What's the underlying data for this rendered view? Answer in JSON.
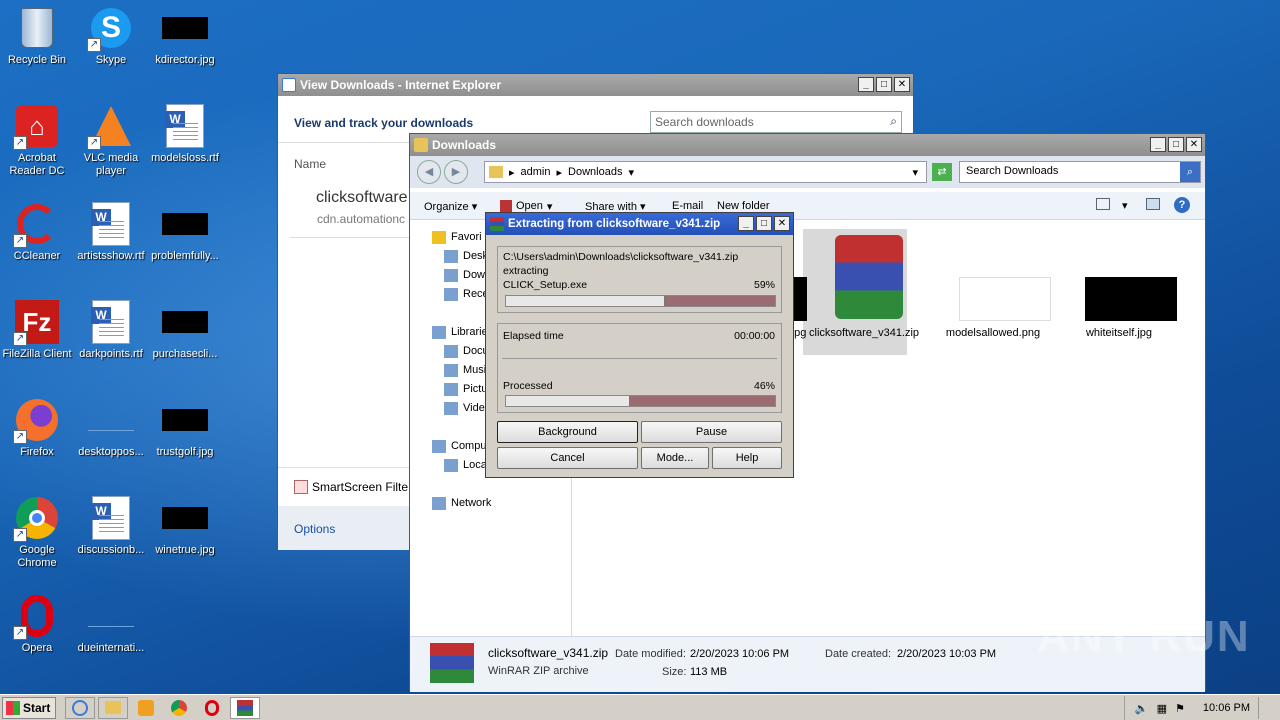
{
  "desktop": {
    "icons": [
      {
        "label": "Recycle Bin",
        "icon": "recycle-bin-icon"
      },
      {
        "label": "Skype",
        "icon": "skype-icon"
      },
      {
        "label": "kdirector.jpg",
        "icon": "image-file-icon"
      },
      {
        "label": "Acrobat Reader DC",
        "icon": "acrobat-icon"
      },
      {
        "label": "VLC media player",
        "icon": "vlc-icon"
      },
      {
        "label": "modelsloss.rtf",
        "icon": "word-document-icon"
      },
      {
        "label": "CCleaner",
        "icon": "ccleaner-icon"
      },
      {
        "label": "artistsshow.rtf",
        "icon": "word-document-icon"
      },
      {
        "label": "problemfully...",
        "icon": "image-file-icon"
      },
      {
        "label": "FileZilla Client",
        "icon": "filezilla-icon"
      },
      {
        "label": "darkpoints.rtf",
        "icon": "word-document-icon"
      },
      {
        "label": "purchasecli...",
        "icon": "image-file-icon"
      },
      {
        "label": "Firefox",
        "icon": "firefox-icon"
      },
      {
        "label": "desktoppos...",
        "icon": "image-file-icon"
      },
      {
        "label": "trustgolf.jpg",
        "icon": "image-file-icon"
      },
      {
        "label": "Google Chrome",
        "icon": "chrome-icon"
      },
      {
        "label": "discussionb...",
        "icon": "word-document-icon"
      },
      {
        "label": "winetrue.jpg",
        "icon": "image-file-icon"
      },
      {
        "label": "Opera",
        "icon": "opera-icon"
      },
      {
        "label": "dueinternati...",
        "icon": "image-file-icon"
      }
    ]
  },
  "ie_window": {
    "title": "View Downloads - Internet Explorer",
    "heading": "View and track your downloads",
    "search_placeholder": "Search downloads",
    "column_name": "Name",
    "item_name": "clicksoftware.",
    "item_source": "cdn.automationc",
    "smartscreen": "SmartScreen Filte",
    "options": "Options"
  },
  "explorer": {
    "title": "Downloads",
    "breadcrumb": [
      "admin",
      "Downloads"
    ],
    "search_placeholder": "Search Downloads",
    "toolbar": [
      "Organize",
      "Open",
      "Share with",
      "E-mail",
      "New folder"
    ],
    "nav": [
      "Favori",
      "Desk",
      "Dow",
      "Rece",
      "Librarie",
      "Docu",
      "Musi",
      "Pictu",
      "Vide",
      "Compu",
      "Loca",
      "Network"
    ],
    "files": [
      {
        "name": "...pg",
        "kind": "black"
      },
      {
        "name": "clicksoftware_v341.zip",
        "kind": "winrar"
      },
      {
        "name": "modelsallowed.png",
        "kind": "white"
      },
      {
        "name": "whiteitself.jpg",
        "kind": "black"
      }
    ],
    "details": {
      "name": "clicksoftware_v341.zip",
      "type": "WinRAR ZIP archive",
      "modified_label": "Date modified:",
      "modified": "2/20/2023 10:06 PM",
      "created_label": "Date created:",
      "created": "2/20/2023 10:03 PM",
      "size_label": "Size:",
      "size": "113 MB"
    }
  },
  "extract_dialog": {
    "title": "Extracting from clicksoftware_v341.zip",
    "path": "C:\\Users\\admin\\Downloads\\clicksoftware_v341.zip",
    "action": "extracting",
    "file": "CLICK_Setup.exe",
    "file_percent": "59%",
    "file_progress": 0.59,
    "elapsed_label": "Elapsed time",
    "elapsed": "00:00:00",
    "processed_label": "Processed",
    "processed_percent": "46%",
    "processed_progress": 0.46,
    "buttons": {
      "background": "Background",
      "pause": "Pause",
      "cancel": "Cancel",
      "mode": "Mode...",
      "help": "Help"
    }
  },
  "taskbar": {
    "start": "Start",
    "clock": "10:06 PM",
    "apps": [
      "ie-icon",
      "explorer-icon",
      "media-player-icon",
      "chrome-icon",
      "opera-icon",
      "winrar-icon"
    ]
  },
  "watermark": "ANY RUN",
  "colors": {
    "progress_fill": "#9b6b72",
    "progress_done": "#e8e8e8",
    "title_inactive": "#9a9a9a",
    "desktop_blue": "#1a68ba"
  }
}
